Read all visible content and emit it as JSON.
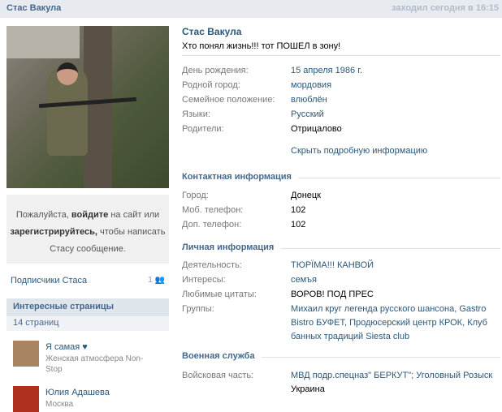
{
  "header": {
    "title": "Стас Вакула",
    "last_seen": "заходил сегодня в 16:15"
  },
  "sidebar": {
    "message": {
      "p1": "Пожалуйста, ",
      "login": "войдите",
      "p2": " на сайт или ",
      "register": "зарегистрируйтесь,",
      "p3": " чтобы написать Стасу сообщение."
    },
    "subscribers": {
      "label": "Подписчики Стаса",
      "count": "1"
    },
    "interesting": {
      "title": "Интересные страницы",
      "count": "14 страниц",
      "items": [
        {
          "name": "Я самая ♥",
          "desc": "Женская атмосфера Non-Stop",
          "color": "#a88460"
        },
        {
          "name": "Юлия Адашева",
          "desc": "Москва",
          "color": "#b03020"
        }
      ]
    }
  },
  "profile": {
    "name": "Стас Вакула",
    "status": "Хто понял жизнь!!! тот ПОШЕЛ в зону!",
    "basic": [
      {
        "label": "День рождения:",
        "value": "15 апреля 1986 г."
      },
      {
        "label": "Родной город:",
        "value": "мордовия"
      },
      {
        "label": "Семейное положение:",
        "value": "влюблён"
      },
      {
        "label": "Языки:",
        "value": "Русский"
      },
      {
        "label": "Родители:",
        "value": "Отрицалово"
      }
    ],
    "hide_link": "Скрыть подробную информацию",
    "contact": {
      "title": "Контактная информация",
      "rows": [
        {
          "label": "Город:",
          "value": "Донецк"
        },
        {
          "label": "Моб. телефон:",
          "value": "102"
        },
        {
          "label": "Доп. телефон:",
          "value": "102"
        }
      ]
    },
    "personal": {
      "title": "Личная информация",
      "rows": [
        {
          "label": "Деятельность:",
          "value": "ТЮРЇМА!!! КАНВОЙ"
        },
        {
          "label": "Интересы:",
          "value": "семъя"
        },
        {
          "label": "Любимые цитаты:",
          "value": "ВОРОВ! ПОД ПРЕС"
        },
        {
          "label": "Группы:",
          "value": "Михаил круг легенда русского шансона, Gastro Bistro БУФЕТ, Продюсерский центр КРОК, Клуб банных традиций Siesta club"
        }
      ]
    },
    "military": {
      "title": "Военная служба",
      "rows": [
        {
          "label": "Войсковая часть:",
          "value": "МВД подр.спецназ\" БЕРКУТ\"; Уголовный Розыск",
          "value2": "Украина"
        }
      ]
    }
  }
}
